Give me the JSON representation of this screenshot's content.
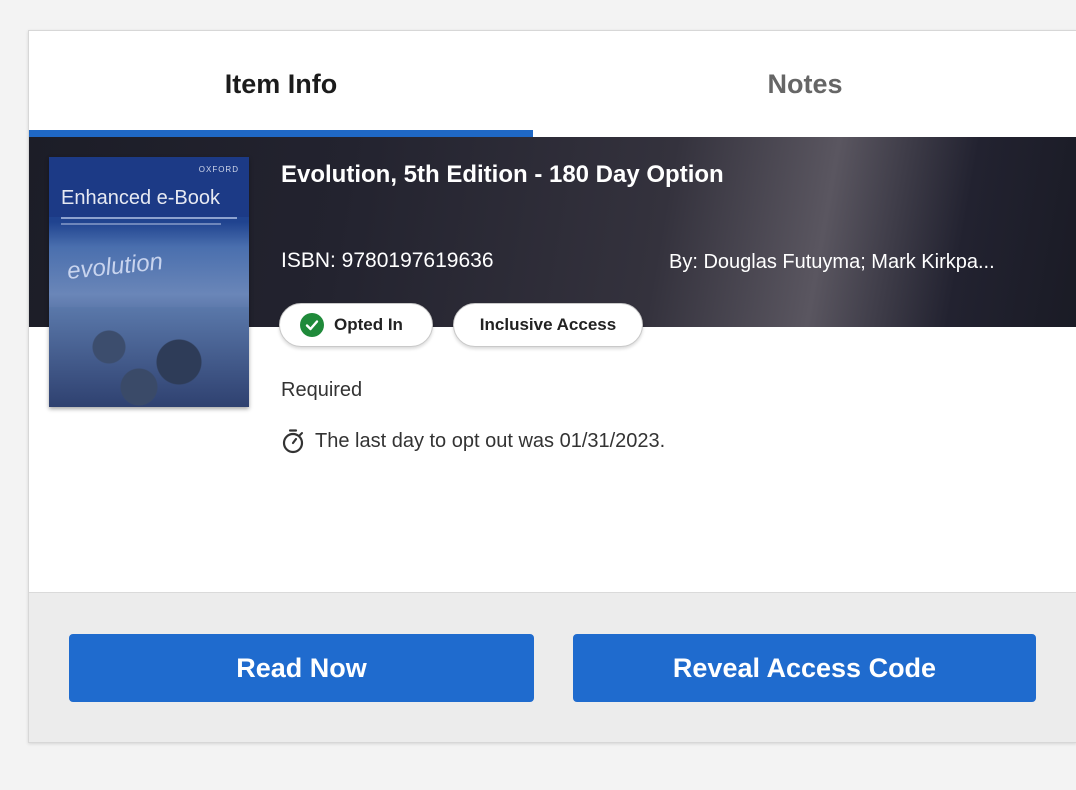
{
  "tabs": [
    {
      "label": "Item Info",
      "active": true
    },
    {
      "label": "Notes",
      "active": false
    }
  ],
  "item": {
    "title": "Evolution, 5th Edition - 180 Day Option",
    "isbn": "ISBN: 9780197619636",
    "authors": "By: Douglas Futuyma; Mark Kirkpa...",
    "cover": {
      "publisher": "OXFORD",
      "label": "Enhanced e-Book",
      "book_title": "evolution"
    },
    "badges": {
      "opted_in": "Opted In",
      "inclusive_access": "Inclusive Access"
    },
    "requirement": "Required",
    "opt_out_message": "The last day to opt out was 01/31/2023."
  },
  "actions": {
    "read_now": "Read Now",
    "reveal_access_code": "Reveal Access Code"
  },
  "colors": {
    "accent": "#1f68c5",
    "button": "#1f6bce",
    "opted_in_check": "#1f8a3a"
  }
}
